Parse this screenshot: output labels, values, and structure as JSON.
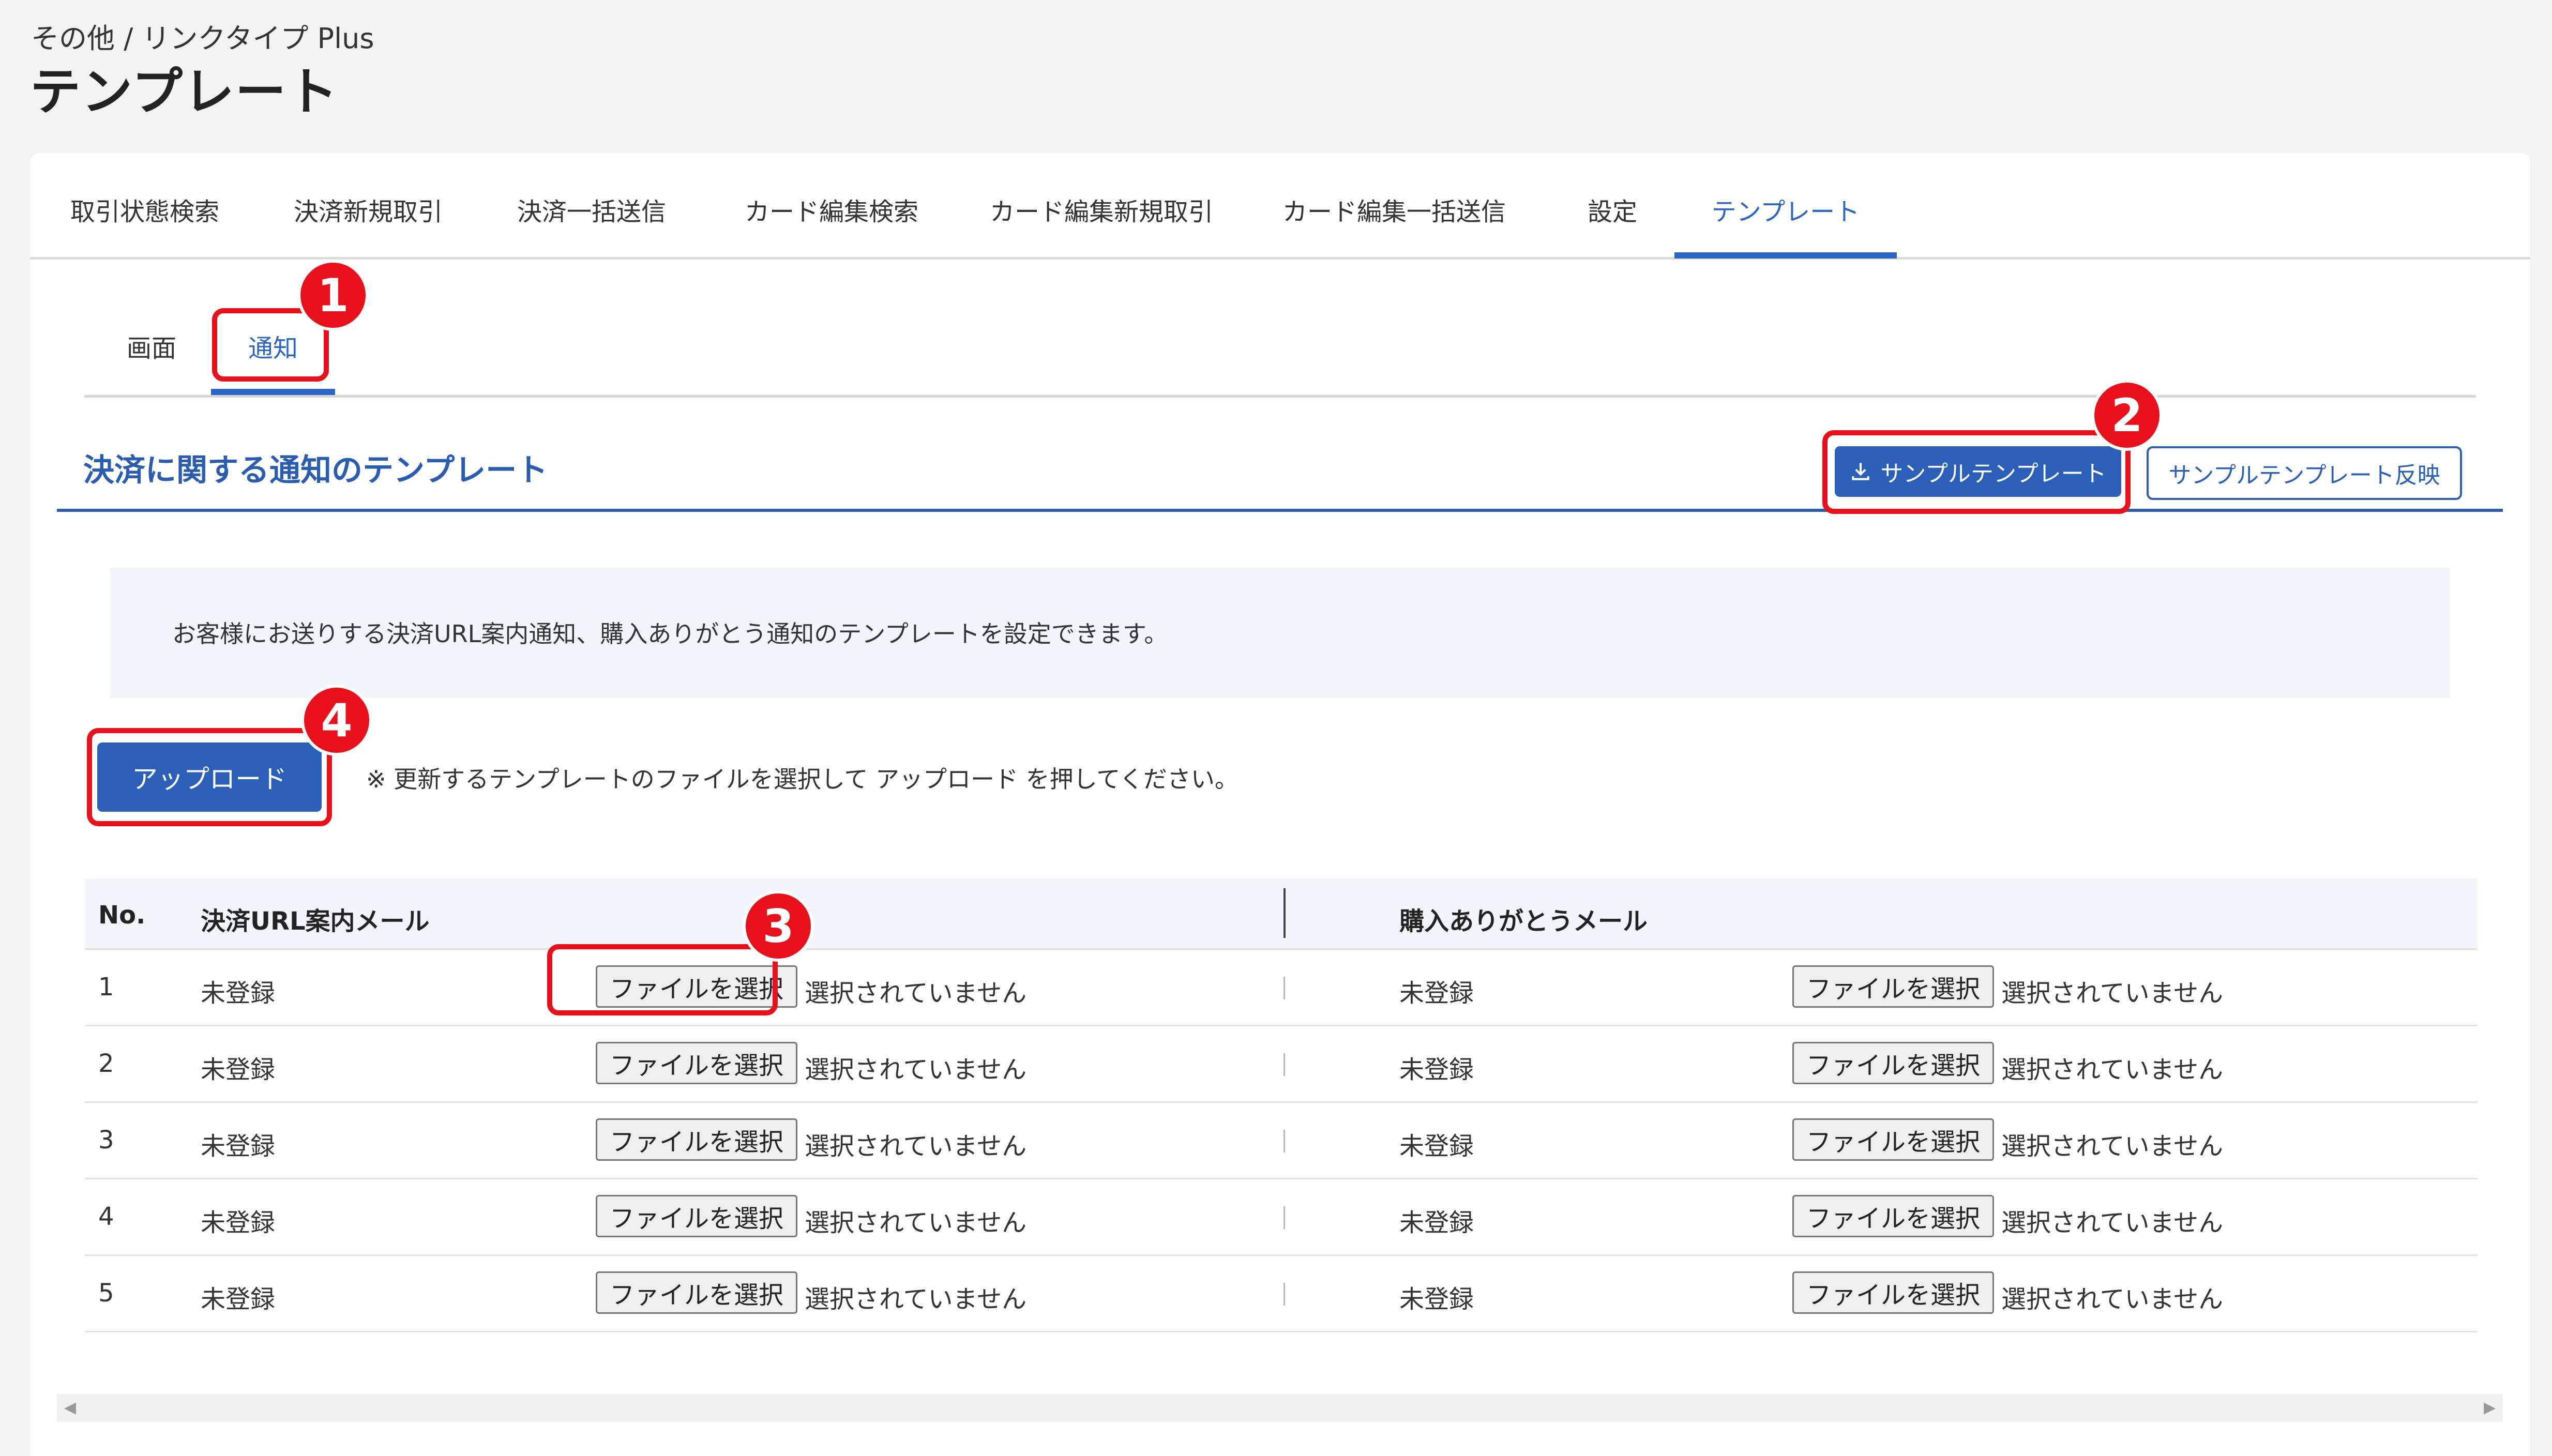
{
  "header": {
    "breadcrumb": "その他 / リンクタイプ Plus",
    "title": "テンプレート"
  },
  "main_tabs": [
    {
      "label": "取引状態検索"
    },
    {
      "label": "決済新規取引"
    },
    {
      "label": "決済一括送信"
    },
    {
      "label": "カード編集検索"
    },
    {
      "label": "カード編集新規取引"
    },
    {
      "label": "カード編集一括送信"
    },
    {
      "label": "設定"
    },
    {
      "label": "テンプレート",
      "active": true
    }
  ],
  "sub_tabs": [
    {
      "label": "画面"
    },
    {
      "label": "通知",
      "active": true
    }
  ],
  "section": {
    "title": "決済に関する通知のテンプレート",
    "sample_button": "サンプルテンプレート",
    "apply_button": "サンプルテンプレート反映"
  },
  "info": {
    "text": "お客様にお送りする決済URL案内通知、購入ありがとう通知のテンプレートを設定できます。"
  },
  "upload": {
    "button": "アップロード",
    "note": "※ 更新するテンプレートのファイルを選択して アップロード を押してください。"
  },
  "table": {
    "headers": {
      "no": "No.",
      "col1": "決済URL案内メール",
      "col2": "購入ありがとうメール"
    },
    "file_button": "ファイルを選択",
    "no_file": "選択されていません",
    "rows": [
      {
        "no": "1",
        "col1_status": "未登録",
        "col2_status": "未登録"
      },
      {
        "no": "2",
        "col1_status": "未登録",
        "col2_status": "未登録"
      },
      {
        "no": "3",
        "col1_status": "未登録",
        "col2_status": "未登録"
      },
      {
        "no": "4",
        "col1_status": "未登録",
        "col2_status": "未登録"
      },
      {
        "no": "5",
        "col1_status": "未登録",
        "col2_status": "未登録"
      }
    ]
  },
  "callouts": [
    "1",
    "2",
    "3",
    "4"
  ],
  "colors": {
    "accent": "#2c5fb8",
    "callout": "#e8101a"
  },
  "icons": {
    "download": "download-icon",
    "scroll_left": "chevron-left-icon",
    "scroll_right": "chevron-right-icon"
  }
}
